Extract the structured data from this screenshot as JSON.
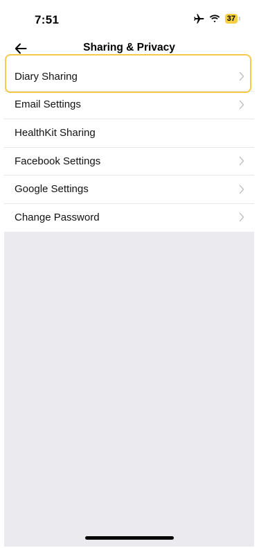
{
  "status_bar": {
    "time": "7:51",
    "battery_level": "37",
    "icons": [
      "airplane-icon",
      "wifi-icon",
      "battery-icon"
    ]
  },
  "nav": {
    "title": "Sharing & Privacy",
    "back_icon": "back-arrow-icon"
  },
  "settings": {
    "items": [
      {
        "label": "Diary Sharing",
        "has_chevron": true,
        "highlighted": true
      },
      {
        "label": "Email Settings",
        "has_chevron": true
      },
      {
        "label": "HealthKit Sharing",
        "has_chevron": false
      },
      {
        "label": "Facebook Settings",
        "has_chevron": true
      },
      {
        "label": "Google Settings",
        "has_chevron": true
      },
      {
        "label": "Change Password",
        "has_chevron": true
      }
    ]
  },
  "colors": {
    "highlight": "#f7c948",
    "battery": "#f5cf3d",
    "background_empty": "#ebebef",
    "separator": "#e5e5ea",
    "chevron": "#c4c4c7"
  }
}
